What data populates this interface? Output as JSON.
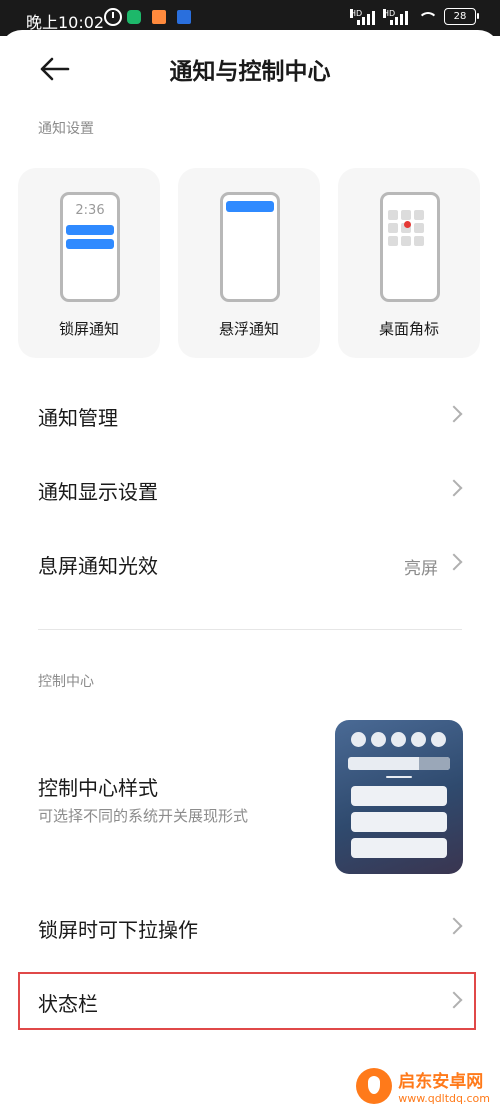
{
  "status_bar": {
    "time": "晚上10:02",
    "signal_badge_1": "HD",
    "signal_badge_2": "HD",
    "battery": "28"
  },
  "header": {
    "title": "通知与控制中心"
  },
  "notify_section": {
    "label": "通知设置",
    "cards": [
      {
        "label": "锁屏通知",
        "clock": "2:36"
      },
      {
        "label": "悬浮通知"
      },
      {
        "label": "桌面角标"
      }
    ],
    "accent_color": "#2f8aff",
    "badge_color": "#e53935"
  },
  "rows": [
    {
      "label": "通知管理"
    },
    {
      "label": "通知显示设置"
    },
    {
      "label": "息屏通知光效",
      "value": "亮屏"
    }
  ],
  "control_section": {
    "label": "控制中心",
    "style_title": "控制中心样式",
    "style_subtitle": "可选择不同的系统开关展现形式"
  },
  "rows2": [
    {
      "label": "锁屏时可下拉操作"
    },
    {
      "label": "状态栏"
    }
  ],
  "highlight_color": "#e04848",
  "watermark": {
    "name": "启东安卓网",
    "url": "www.qdltdq.com"
  }
}
